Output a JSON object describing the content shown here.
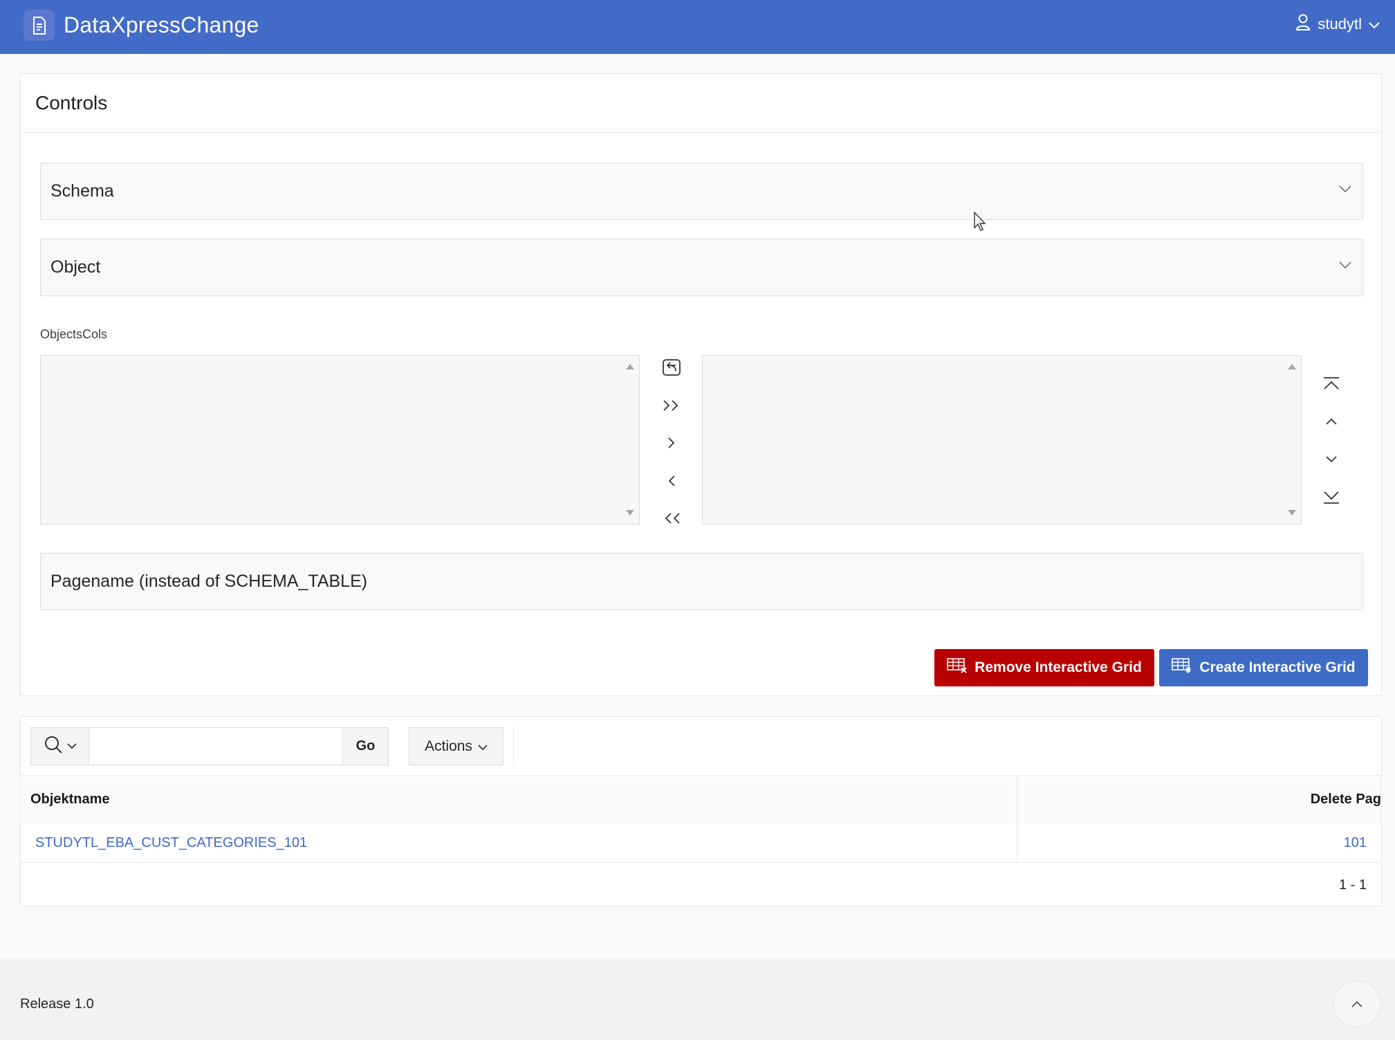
{
  "app": {
    "title": "DataXpressChange"
  },
  "user": {
    "name": "studytl"
  },
  "controls": {
    "title": "Controls",
    "schema_label": "Schema",
    "object_label": "Object",
    "shuttle_label": "ObjectsCols",
    "pagename_placeholder": "Pagename (instead of SCHEMA_TABLE)",
    "remove_button": "Remove Interactive Grid",
    "create_button": "Create Interactive Grid"
  },
  "report": {
    "search_value": "",
    "go_label": "Go",
    "actions_label": "Actions",
    "columns": [
      "Objektname",
      "Delete Pag"
    ],
    "rows": [
      {
        "objektname": "STUDYTL_EBA_CUST_CATEGORIES_101",
        "delete_page": "101"
      }
    ],
    "pagination": "1 - 1"
  },
  "footer": {
    "release": "Release 1.0"
  },
  "colors": {
    "header": "#426bc7",
    "remove": "#b80000",
    "create": "#3d6bc6",
    "link": "#3f68c3"
  }
}
